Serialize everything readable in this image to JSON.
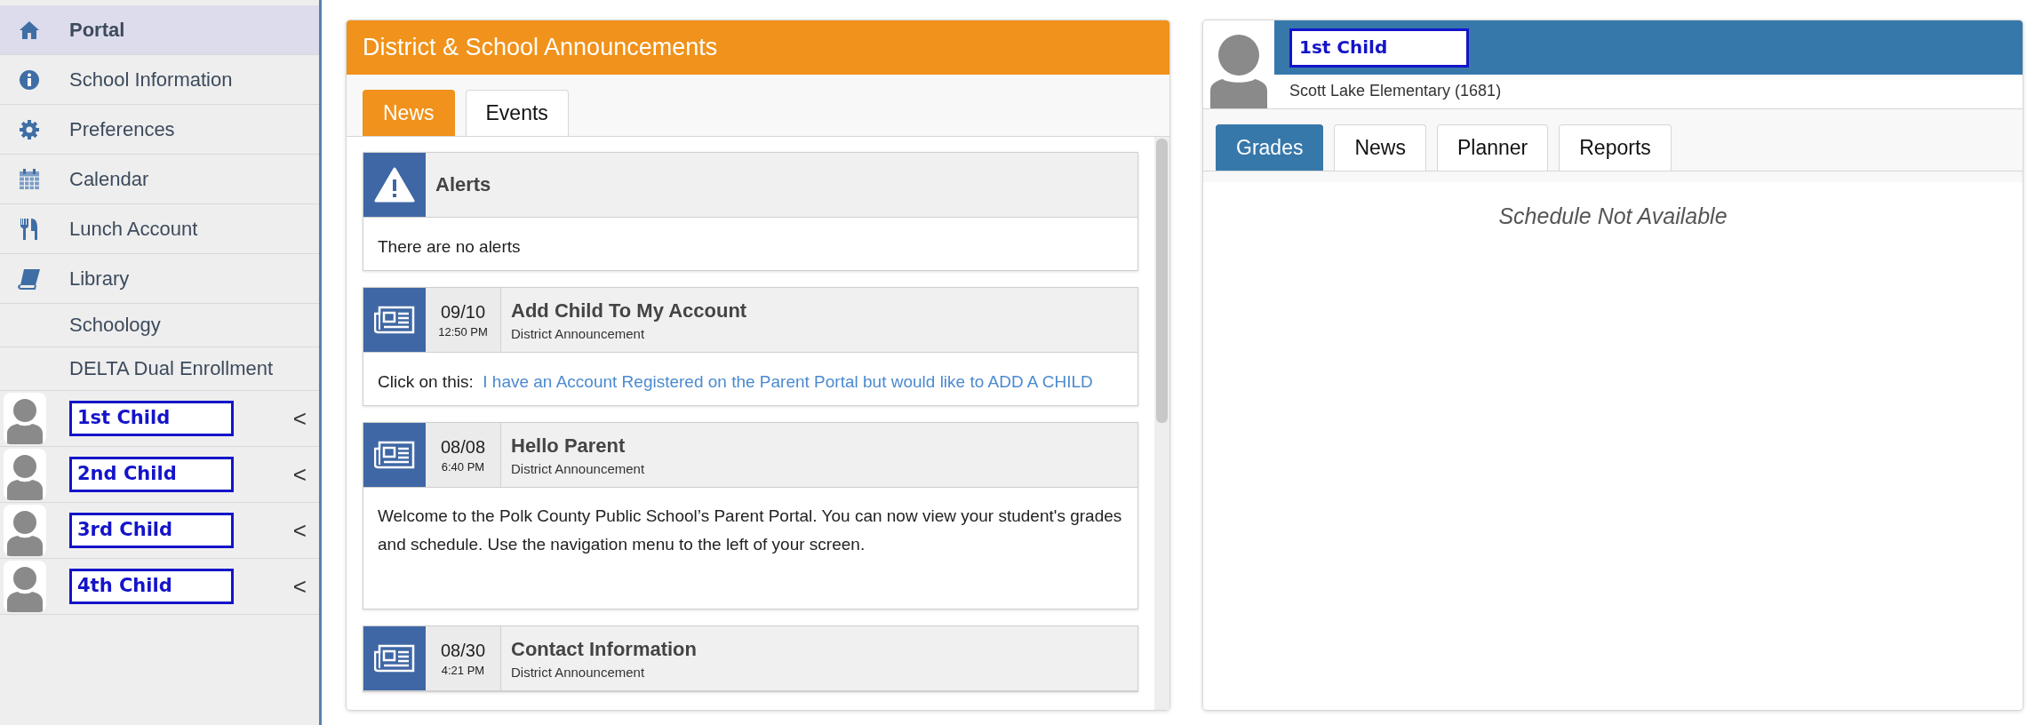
{
  "sidebar": {
    "items": [
      {
        "label": "Portal",
        "selected": true
      },
      {
        "label": "School Information",
        "selected": false
      },
      {
        "label": "Preferences",
        "selected": false
      },
      {
        "label": "Calendar",
        "selected": false
      },
      {
        "label": "Lunch Account",
        "selected": false
      },
      {
        "label": "Library",
        "selected": false
      },
      {
        "label": "Schoology",
        "selected": false
      },
      {
        "label": "DELTA Dual Enrollment",
        "selected": false
      }
    ],
    "children": [
      {
        "name": "1st Child",
        "expand_glyph": "<"
      },
      {
        "name": "2nd Child",
        "expand_glyph": "<"
      },
      {
        "name": "3rd Child",
        "expand_glyph": "<"
      },
      {
        "name": "4th Child",
        "expand_glyph": "<"
      }
    ]
  },
  "announcements": {
    "title": "District & School Announcements",
    "tabs": [
      {
        "label": "News",
        "selected": true
      },
      {
        "label": "Events",
        "selected": false
      }
    ],
    "items": [
      {
        "kind": "alert",
        "title": "Alerts",
        "body": "There are no alerts"
      },
      {
        "kind": "news",
        "date": "09/10",
        "time": "12:50 PM",
        "title": "Add Child To My Account",
        "subtitle": "District Announcement",
        "body": "Click on this:",
        "link": "I have an Account Registered on the Parent Portal but would like to ADD A CHILD"
      },
      {
        "kind": "news",
        "date": "08/08",
        "time": "6:40 PM",
        "title": "Hello Parent",
        "subtitle": "District Announcement",
        "body": "Welcome to the Polk County Public School’s Parent Portal. You can now view your student's grades and schedule. Use the navigation menu to the left of your screen."
      },
      {
        "kind": "news",
        "date": "08/30",
        "time": "4:21 PM",
        "title": "Contact Information",
        "subtitle": "District Announcement"
      }
    ]
  },
  "student": {
    "name": "1st Child",
    "school": "Scott Lake Elementary (1681)",
    "tabs": [
      {
        "label": "Grades",
        "selected": true
      },
      {
        "label": "News",
        "selected": false
      },
      {
        "label": "Planner",
        "selected": false
      },
      {
        "label": "Reports",
        "selected": false
      }
    ],
    "message": "Schedule Not Available"
  }
}
